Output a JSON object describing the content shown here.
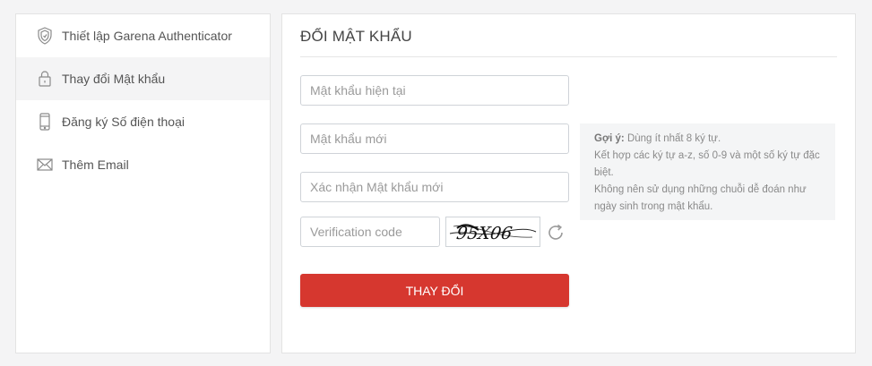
{
  "sidebar": {
    "items": [
      {
        "label": "Thiết lập Garena Authenticator",
        "icon": "shield-icon"
      },
      {
        "label": "Thay đổi Mật khẩu",
        "icon": "lock-icon",
        "active": true
      },
      {
        "label": "Đăng ký Số điện thoại",
        "icon": "phone-icon"
      },
      {
        "label": "Thêm Email",
        "icon": "mail-icon"
      }
    ]
  },
  "main": {
    "title": "ĐỔI MẬT KHẨU",
    "fields": {
      "current_password_placeholder": "Mật khẩu hiện tại",
      "new_password_placeholder": "Mật khẩu mới",
      "confirm_password_placeholder": "Xác nhận Mật khẩu mới",
      "verification_placeholder": "Verification code"
    },
    "captcha_text": "95X06",
    "hint": {
      "label": "Gợi ý:",
      "line1": "Dùng ít nhất 8 ký tự.",
      "line2": "Kết hợp các ký tự a-z, số 0-9 và một số ký tự đặc biệt.",
      "line3": "Không nên sử dụng những chuỗi dễ đoán như ngày sinh trong mật khẩu."
    },
    "submit_label": "THAY ĐỔI"
  },
  "colors": {
    "accent": "#d6372f",
    "active_bg": "#f4f4f5"
  }
}
